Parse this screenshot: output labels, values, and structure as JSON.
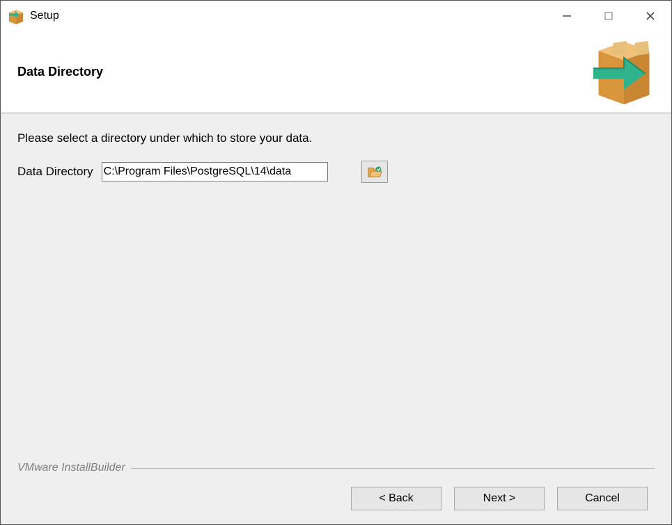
{
  "window": {
    "title": "Setup"
  },
  "header": {
    "page_title": "Data Directory"
  },
  "body": {
    "instruction": "Please select a directory under which to store your data.",
    "field_label": "Data Directory",
    "directory_value": "C:\\Program Files\\PostgreSQL\\14\\data"
  },
  "footer": {
    "brand": "VMware InstallBuilder",
    "back_label": "< Back",
    "next_label": "Next >",
    "cancel_label": "Cancel"
  }
}
